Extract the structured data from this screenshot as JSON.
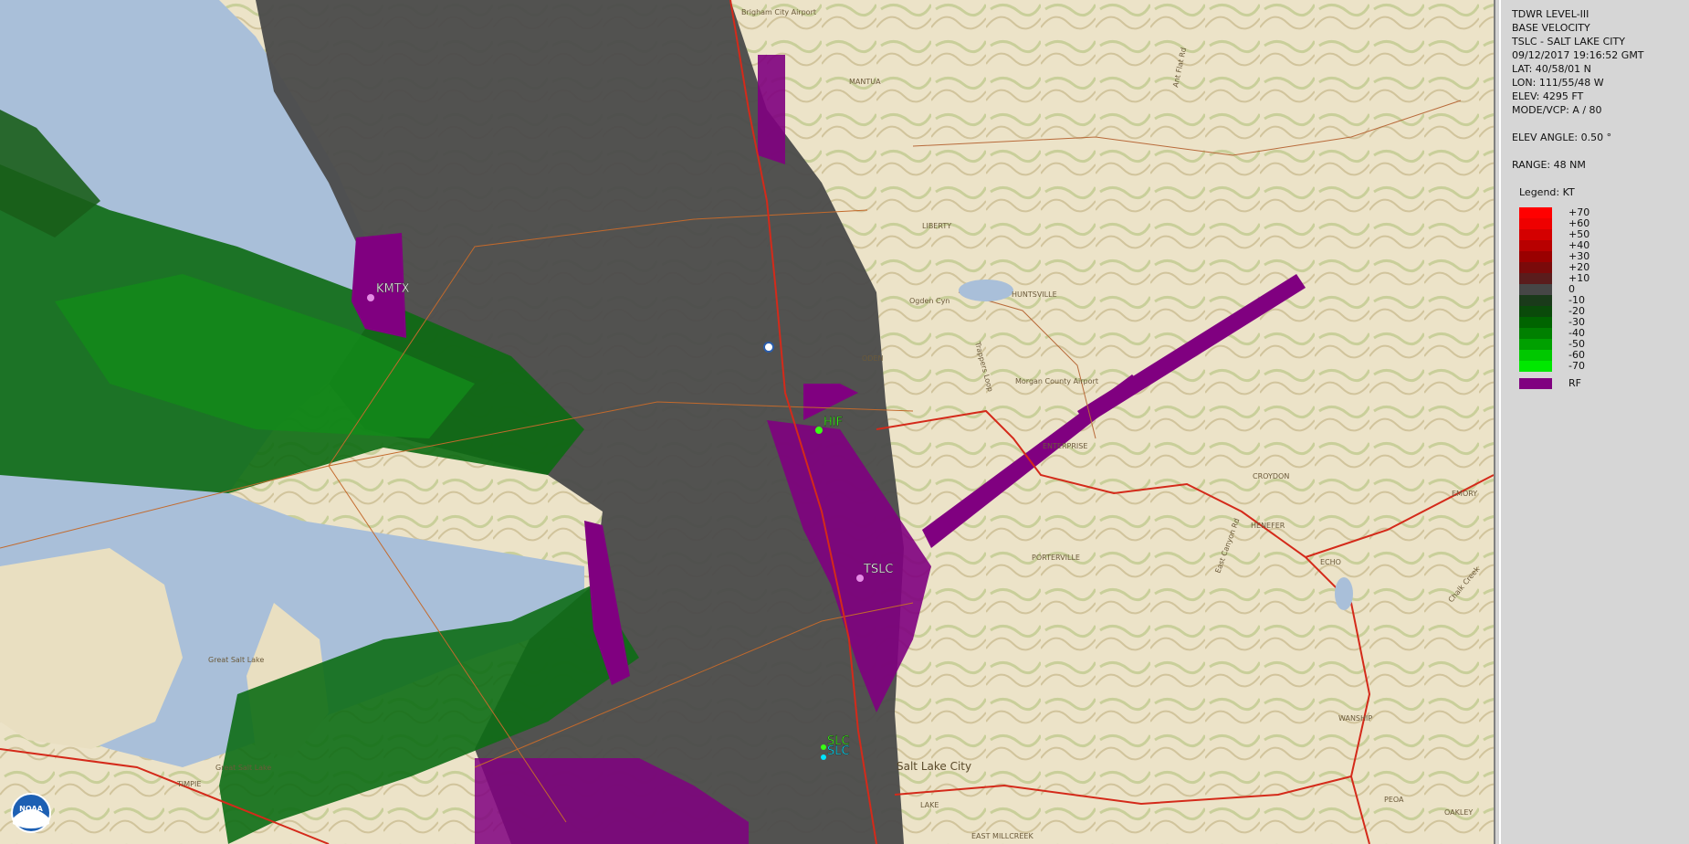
{
  "panel": {
    "lines": [
      "TDWR LEVEL-III",
      "BASE VELOCITY",
      "TSLC - SALT LAKE CITY",
      "09/12/2017 19:16:52 GMT",
      "LAT: 40/58/01 N",
      "LON: 111/55/48 W",
      "ELEV: 4295 FT",
      "MODE/VCP: A / 80"
    ],
    "elev_angle": "ELEV ANGLE: 0.50 °",
    "range": "RANGE: 48 NM",
    "legend_title": "Legend: KT",
    "legend": [
      {
        "label": "+70",
        "color": "#ff0000"
      },
      {
        "label": "+60",
        "color": "#ee0000"
      },
      {
        "label": "+50",
        "color": "#d40000"
      },
      {
        "label": "+40",
        "color": "#b80000"
      },
      {
        "label": "+30",
        "color": "#9a0000"
      },
      {
        "label": "+20",
        "color": "#7a0a0a"
      },
      {
        "label": "+10",
        "color": "#5a1c1c"
      },
      {
        "label": "0",
        "color": "#464646"
      },
      {
        "label": "-10",
        "color": "#1a3a1a"
      },
      {
        "label": "-20",
        "color": "#0a4a0a"
      },
      {
        "label": "-30",
        "color": "#006400"
      },
      {
        "label": "-40",
        "color": "#008000"
      },
      {
        "label": "-50",
        "color": "#00a000"
      },
      {
        "label": "-60",
        "color": "#00c800"
      },
      {
        "label": "-70",
        "color": "#00e800"
      }
    ],
    "rf_label": "RF",
    "rf_color": "#800080"
  },
  "map": {
    "sites": [
      {
        "label": "KMTX",
        "color": "#ffffff"
      },
      {
        "label": "HIF",
        "color": "#39ff14"
      },
      {
        "label": "TSLC",
        "color": "#ffffff"
      },
      {
        "label": "SLC",
        "color": "#39ff14"
      },
      {
        "label": "SLC",
        "color": "#00e5ff"
      }
    ],
    "places": [
      "Brigham City Airport",
      "MANTUA",
      "LIBERTY",
      "HUNTSVILLE",
      "Ogden Cyn",
      "ODEN",
      "Morgan County Airport",
      "ENTERPRISE",
      "CROYDON",
      "HENEFER",
      "ECHO",
      "PORTERVILLE",
      "Great Salt Lake",
      "Great Salt Lake",
      "TIMPIE",
      "WANSHIP",
      "PEOA",
      "OAKLEY",
      "EMORY",
      "LAKE",
      "EAST MILLCREEK",
      "Salt Lake City",
      "Ant Flat Rd",
      "East Canyon Rd",
      "Chalk Creek",
      "Trappers Loop"
    ],
    "logo": "NOAA"
  }
}
